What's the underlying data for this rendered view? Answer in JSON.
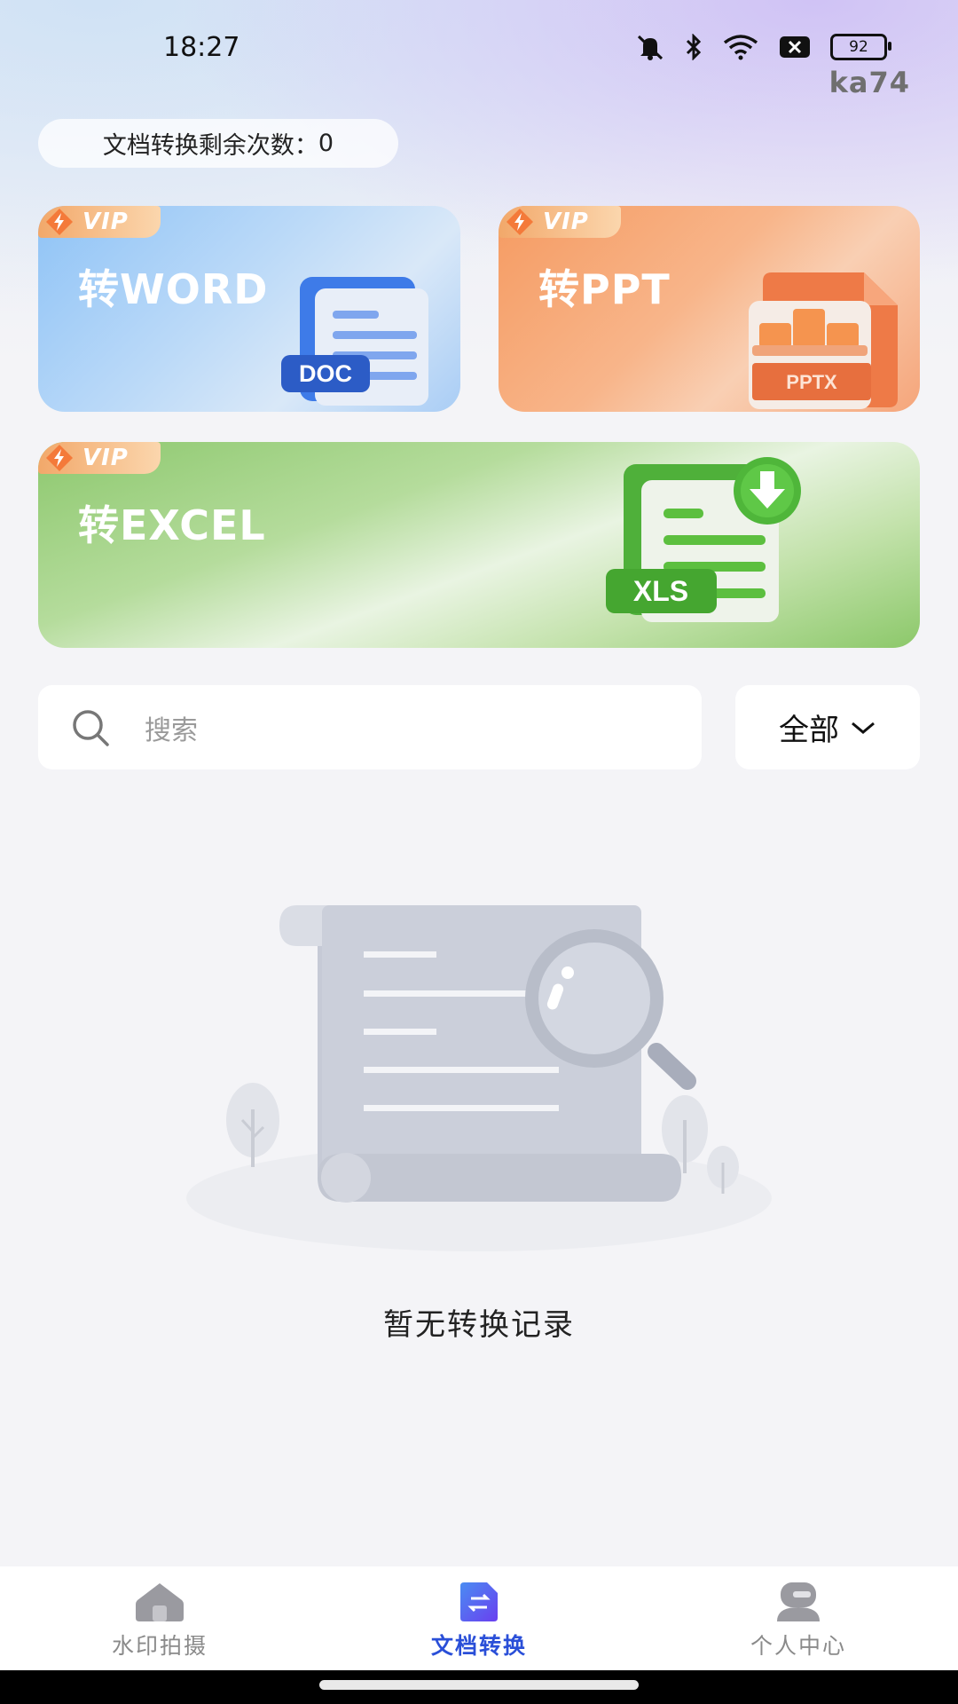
{
  "status_bar": {
    "time": "18:27",
    "battery": "92"
  },
  "watermark": "ka74",
  "quota": {
    "label": "文档转换剩余次数：",
    "count": "0"
  },
  "cards": [
    {
      "badge": "VIP",
      "title": "转WORD",
      "file_tag": "DOC",
      "color": "#8fc3f6"
    },
    {
      "badge": "VIP",
      "title": "转PPT",
      "file_tag": "PPTX",
      "color": "#f59b62"
    },
    {
      "badge": "VIP",
      "title": "转EXCEL",
      "file_tag": "XLS",
      "color": "#8dc86e"
    }
  ],
  "search": {
    "placeholder": "搜索",
    "icon": "search-icon"
  },
  "filter": {
    "label": "全部",
    "icon": "chevron-down-icon"
  },
  "empty_state": {
    "text": "暂无转换记录"
  },
  "bottom_nav": [
    {
      "label": "水印拍摄",
      "icon": "home-icon",
      "active": false
    },
    {
      "label": "文档转换",
      "icon": "convert-doc-icon",
      "active": true
    },
    {
      "label": "个人中心",
      "icon": "profile-icon",
      "active": false
    }
  ],
  "colors": {
    "accent": "#2a4fd8",
    "inactive": "#8a8a8a"
  }
}
